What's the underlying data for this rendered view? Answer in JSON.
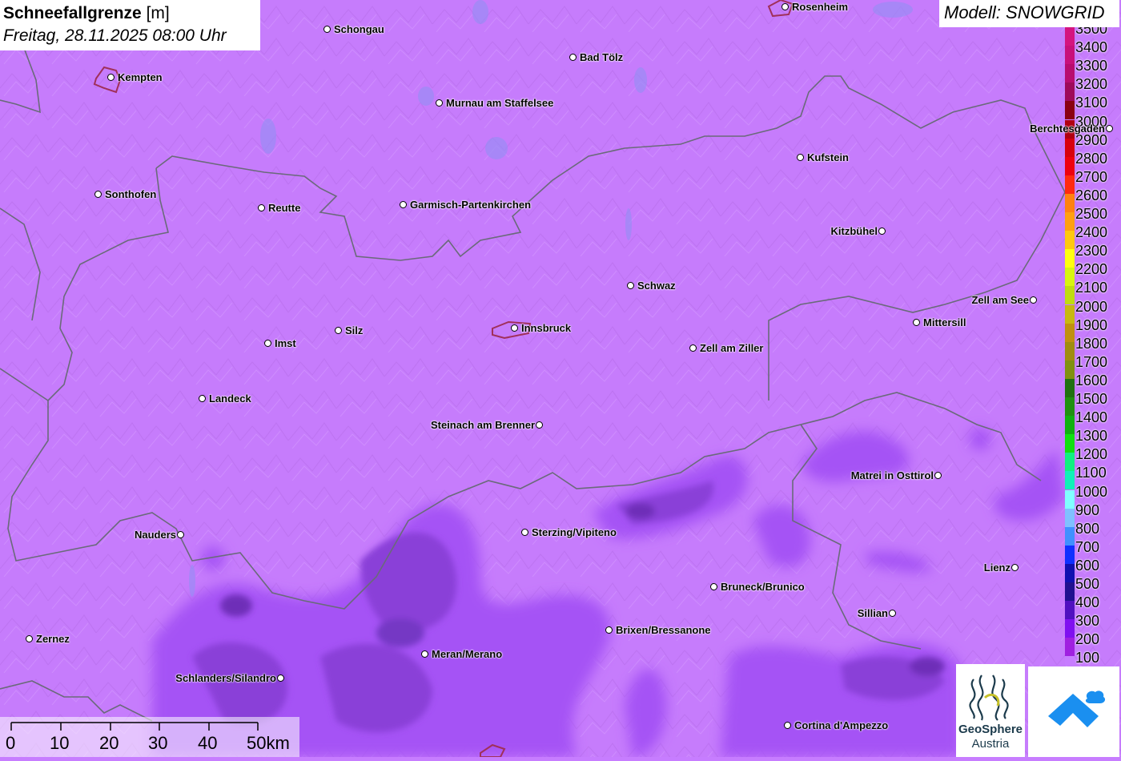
{
  "title": {
    "param": "Schneefallgrenze",
    "unit": "[m]",
    "datetime": "Freitag, 28.11.2025 08:00 Uhr"
  },
  "model": "Modell: SNOWGRID",
  "legend": [
    {
      "label": "3500",
      "color": "#d4147f"
    },
    {
      "label": "3400",
      "color": "#c8107a"
    },
    {
      "label": "3300",
      "color": "#b80c6e"
    },
    {
      "label": "3200",
      "color": "#9e0a5a"
    },
    {
      "label": "3100",
      "color": "#8a0012"
    },
    {
      "label": "3000",
      "color": "#b00010"
    },
    {
      "label": "2900",
      "color": "#d8000e"
    },
    {
      "label": "2800",
      "color": "#ee0010"
    },
    {
      "label": "2700",
      "color": "#ff2a10"
    },
    {
      "label": "2600",
      "color": "#ff8210"
    },
    {
      "label": "2500",
      "color": "#ffa010"
    },
    {
      "label": "2400",
      "color": "#ffc810"
    },
    {
      "label": "2300",
      "color": "#ffff10"
    },
    {
      "label": "2200",
      "color": "#d8f510"
    },
    {
      "label": "2100",
      "color": "#c0dc10"
    },
    {
      "label": "2000",
      "color": "#c8b810"
    },
    {
      "label": "1900",
      "color": "#c09010"
    },
    {
      "label": "1800",
      "color": "#a08c10"
    },
    {
      "label": "1700",
      "color": "#809010"
    },
    {
      "label": "1600",
      "color": "#207010"
    },
    {
      "label": "1500",
      "color": "#209010"
    },
    {
      "label": "1400",
      "color": "#10b010"
    },
    {
      "label": "1300",
      "color": "#10e010"
    },
    {
      "label": "1200",
      "color": "#10f080"
    },
    {
      "label": "1100",
      "color": "#10f0b8"
    },
    {
      "label": "1000",
      "color": "#80ffff"
    },
    {
      "label": "900",
      "color": "#80c0ff"
    },
    {
      "label": "800",
      "color": "#4090ff"
    },
    {
      "label": "700",
      "color": "#1030ff"
    },
    {
      "label": "600",
      "color": "#1010b0"
    },
    {
      "label": "500",
      "color": "#201090"
    },
    {
      "label": "400",
      "color": "#5010c0"
    },
    {
      "label": "300",
      "color": "#8010f0"
    },
    {
      "label": "200",
      "color": "#a020e0"
    },
    {
      "label": "100",
      "color": "#c77dff"
    }
  ],
  "cities": [
    {
      "name": "Schongau",
      "label_side": "right"
    },
    {
      "name": "Rosenheim",
      "label_side": "right"
    },
    {
      "name": "Kempten",
      "label_side": "right"
    },
    {
      "name": "Bad Tölz",
      "label_side": "right"
    },
    {
      "name": "Murnau am Staffelsee",
      "label_side": "right"
    },
    {
      "name": "Berchtesgaden",
      "label_side": "left"
    },
    {
      "name": "Kufstein",
      "label_side": "right"
    },
    {
      "name": "Sonthofen",
      "label_side": "right"
    },
    {
      "name": "Reutte",
      "label_side": "right"
    },
    {
      "name": "Garmisch-Partenkirchen",
      "label_side": "right"
    },
    {
      "name": "Kitzbühel",
      "label_side": "left"
    },
    {
      "name": "Schwaz",
      "label_side": "right"
    },
    {
      "name": "Zell am See",
      "label_side": "left"
    },
    {
      "name": "Mittersill",
      "label_side": "right"
    },
    {
      "name": "Silz",
      "label_side": "right"
    },
    {
      "name": "Innsbruck",
      "label_side": "right"
    },
    {
      "name": "Imst",
      "label_side": "right"
    },
    {
      "name": "Zell am Ziller",
      "label_side": "right"
    },
    {
      "name": "Landeck",
      "label_side": "right"
    },
    {
      "name": "Steinach am Brenner",
      "label_side": "left"
    },
    {
      "name": "Matrei in Osttirol",
      "label_side": "left"
    },
    {
      "name": "Nauders",
      "label_side": "left"
    },
    {
      "name": "Sterzing/Vipiteno",
      "label_side": "right"
    },
    {
      "name": "Lienz",
      "label_side": "left"
    },
    {
      "name": "Bruneck/Brunico",
      "label_side": "right"
    },
    {
      "name": "Sillian",
      "label_side": "left"
    },
    {
      "name": "Brixen/Bressanone",
      "label_side": "right"
    },
    {
      "name": "Zernez",
      "label_side": "right"
    },
    {
      "name": "Meran/Merano",
      "label_side": "right"
    },
    {
      "name": "Schlanders/Silandro",
      "label_side": "left"
    },
    {
      "name": "Cortina d'Ampezzo",
      "label_side": "right"
    }
  ],
  "scale": {
    "labels": [
      "0",
      "10",
      "20",
      "30",
      "40",
      "50km"
    ]
  },
  "logos": {
    "geosphere_line1": "GeoSphere",
    "geosphere_line2": "Austria"
  }
}
